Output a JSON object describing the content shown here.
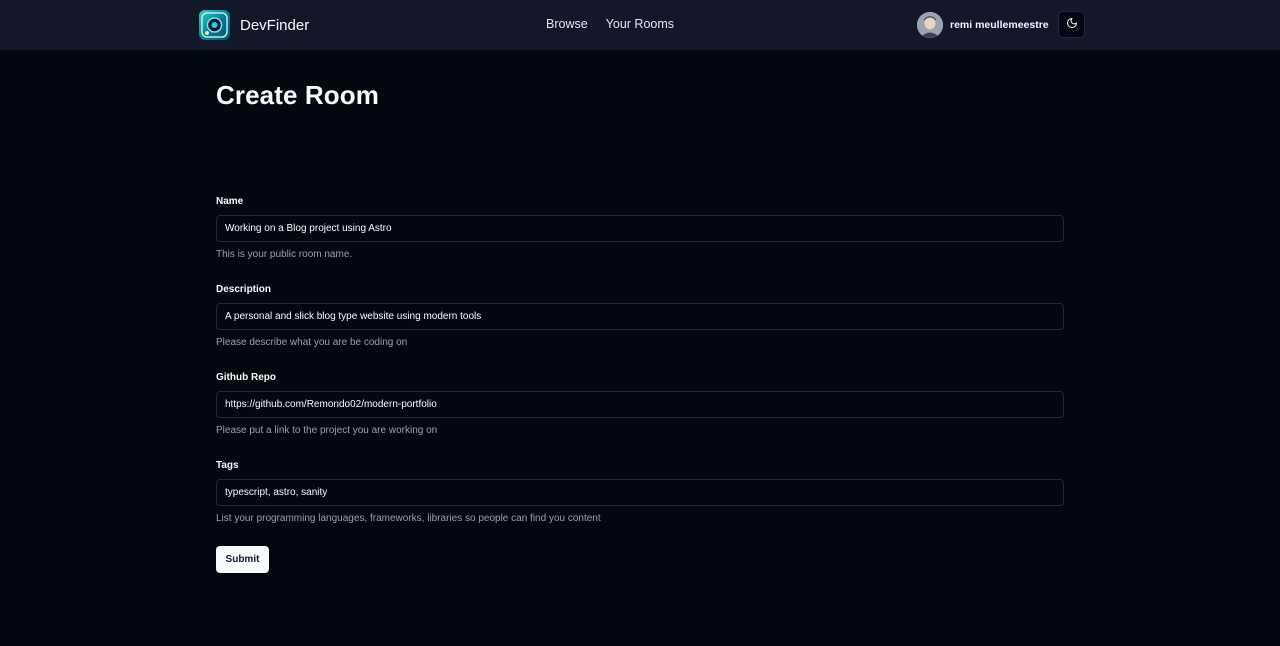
{
  "navbar": {
    "brand": "DevFinder",
    "links": [
      {
        "label": "Browse"
      },
      {
        "label": "Your Rooms"
      }
    ],
    "user_name": "remi meullemeestre",
    "theme_icon": "moon-icon"
  },
  "page": {
    "title": "Create Room"
  },
  "form": {
    "fields": [
      {
        "label": "Name",
        "value": "Working on a Blog project using Astro",
        "help": "This is your public room name."
      },
      {
        "label": "Description",
        "value": "A personal and slick blog type website using modern tools",
        "help": "Please describe what you are be coding on"
      },
      {
        "label": "Github Repo",
        "value": "https://github.com/Remondo02/modern-portfolio",
        "help": "Please put a link to the project you are working on"
      },
      {
        "label": "Tags",
        "value": "typescript, astro, sanity",
        "help": "List your programming languages, frameworks, libraries so people can find you content"
      }
    ],
    "submit_label": "Submit"
  },
  "colors": {
    "background": "#030712",
    "navbar": "#111827",
    "input_border": "#1f2937",
    "muted_text": "#94a3b8",
    "button_bg": "#f8fafc"
  }
}
